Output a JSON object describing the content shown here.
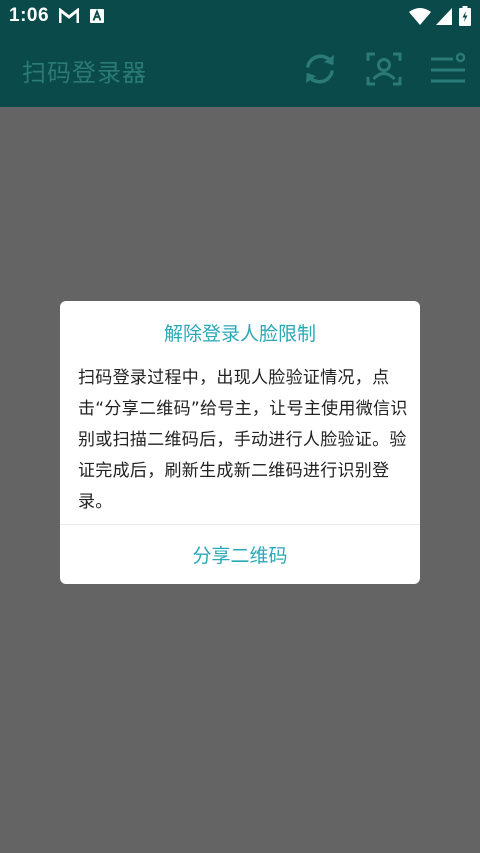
{
  "status_bar": {
    "time": "1:06",
    "notification_icons": [
      "gmail-icon",
      "app-a-icon"
    ],
    "system_icons": [
      "wifi-icon",
      "signal-icon",
      "battery-charging-icon"
    ]
  },
  "app_bar": {
    "title": "扫码登录器",
    "actions": [
      "refresh-icon",
      "face-scan-icon",
      "menu-icon"
    ]
  },
  "dialog": {
    "title": "解除登录人脸限制",
    "body": "扫码登录过程中，出现人脸验证情况，点击“分享二维码”给号主，让号主使用微信识别或扫描二维码后，手动进行人脸验证。验证完成后，刷新生成新二维码进行识别登录。",
    "action_label": "分享二维码"
  },
  "colors": {
    "app_bar_bg": "#0b4a4a",
    "title_color": "#2a7a78",
    "accent": "#2aa8b8",
    "scrim": "#646464"
  }
}
